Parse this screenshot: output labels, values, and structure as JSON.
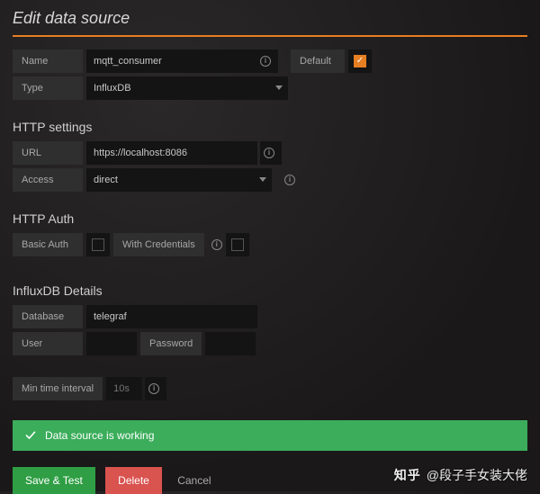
{
  "title": "Edit data source",
  "labels": {
    "name": "Name",
    "default": "Default",
    "type": "Type"
  },
  "values": {
    "name": "mqtt_consumer",
    "type": "InfluxDB",
    "default_checked": true
  },
  "http_settings": {
    "heading": "HTTP settings",
    "url_label": "URL",
    "url_value": "https://localhost:8086",
    "access_label": "Access",
    "access_value": "direct"
  },
  "http_auth": {
    "heading": "HTTP Auth",
    "basic_auth_label": "Basic Auth",
    "basic_auth_checked": false,
    "with_credentials_label": "With Credentials",
    "with_credentials_checked": false
  },
  "influx": {
    "heading": "InfluxDB Details",
    "database_label": "Database",
    "database_value": "telegraf",
    "user_label": "User",
    "user_value": "",
    "password_label": "Password",
    "password_value": ""
  },
  "min_interval": {
    "label": "Min time interval",
    "value": "10s"
  },
  "alert": {
    "message": "Data source is working"
  },
  "buttons": {
    "save": "Save & Test",
    "delete": "Delete",
    "cancel": "Cancel"
  },
  "watermark": {
    "site": "知乎",
    "author": "@段子手女装大佬"
  }
}
